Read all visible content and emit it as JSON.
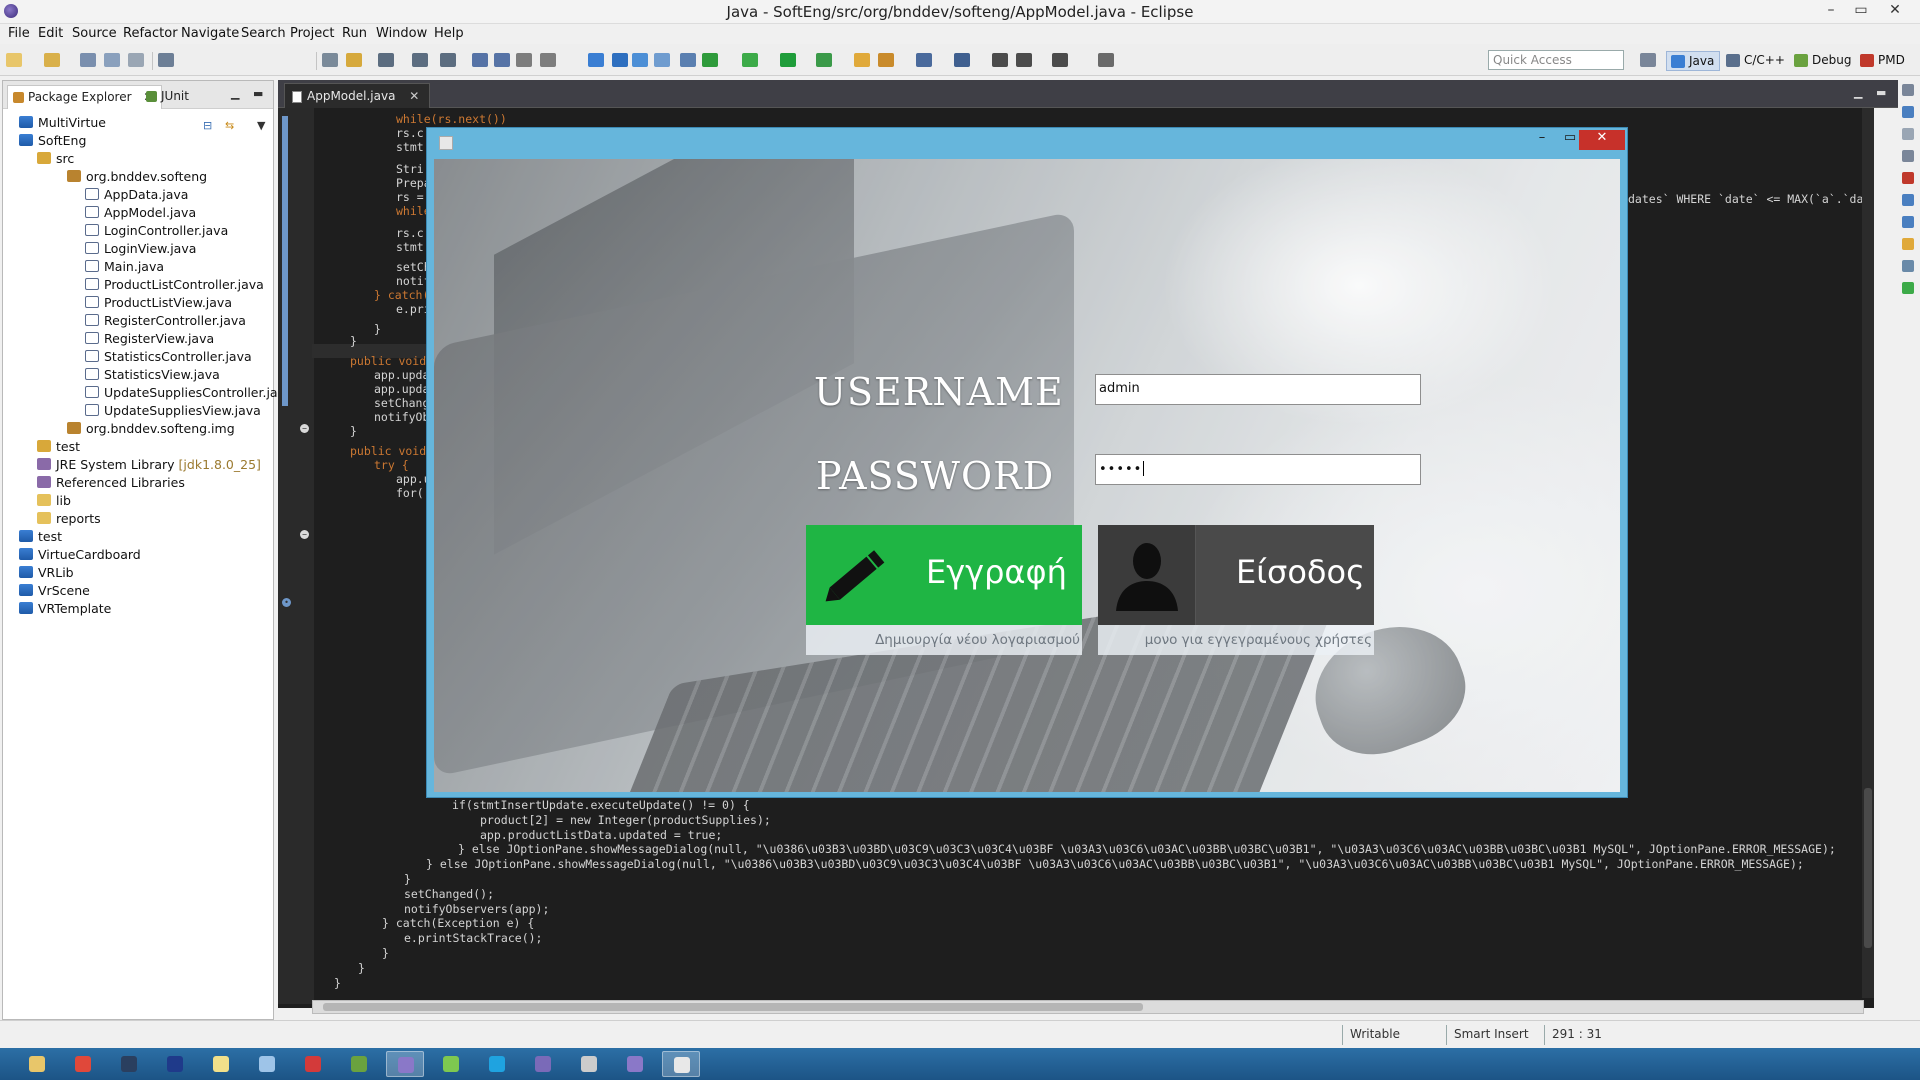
{
  "window": {
    "title": "Java - SoftEng/src/org/bnddev/softeng/AppModel.java - Eclipse",
    "controls": [
      "–",
      "▭",
      "✕"
    ]
  },
  "menu": [
    "File",
    "Edit",
    "Source",
    "Refactor",
    "Navigate",
    "Search",
    "Project",
    "Run",
    "Window",
    "Help"
  ],
  "toolbar": {
    "quick_access_placeholder": "Quick Access",
    "perspectives": [
      {
        "label": "Java",
        "active": true
      },
      {
        "label": "C/C++",
        "active": false
      },
      {
        "label": "Debug",
        "active": false
      },
      {
        "label": "PMD",
        "active": false
      }
    ]
  },
  "left_panel": {
    "tabs": [
      {
        "label": "Package Explorer",
        "active": true,
        "closable": true
      },
      {
        "label": "JUnit",
        "active": false,
        "closable": false
      }
    ],
    "tree": [
      {
        "label": "MultiVirtue",
        "icon": "project-icon",
        "depth": 0
      },
      {
        "label": "SoftEng",
        "icon": "project-icon",
        "depth": 0
      },
      {
        "label": "src",
        "icon": "source-folder-icon",
        "depth": 1
      },
      {
        "label": "org.bnddev.softeng",
        "icon": "package-icon",
        "depth": 2
      },
      {
        "label": "AppData.java",
        "icon": "java-file-icon",
        "depth": 3
      },
      {
        "label": "AppModel.java",
        "icon": "java-file-icon",
        "depth": 3
      },
      {
        "label": "LoginController.java",
        "icon": "java-file-icon",
        "depth": 3
      },
      {
        "label": "LoginView.java",
        "icon": "java-file-icon",
        "depth": 3
      },
      {
        "label": "Main.java",
        "icon": "java-file-icon",
        "depth": 3
      },
      {
        "label": "ProductListController.java",
        "icon": "java-file-icon",
        "depth": 3
      },
      {
        "label": "ProductListView.java",
        "icon": "java-file-icon",
        "depth": 3
      },
      {
        "label": "RegisterController.java",
        "icon": "java-file-icon",
        "depth": 3
      },
      {
        "label": "RegisterView.java",
        "icon": "java-file-icon",
        "depth": 3
      },
      {
        "label": "StatisticsController.java",
        "icon": "java-file-icon",
        "depth": 3
      },
      {
        "label": "StatisticsView.java",
        "icon": "java-file-icon",
        "depth": 3
      },
      {
        "label": "UpdateSuppliesController.java",
        "icon": "java-file-icon",
        "depth": 3
      },
      {
        "label": "UpdateSuppliesView.java",
        "icon": "java-file-icon",
        "depth": 3
      },
      {
        "label": "org.bnddev.softeng.img",
        "icon": "package-icon",
        "depth": 2
      },
      {
        "label": "test",
        "icon": "source-folder-icon",
        "depth": 1
      },
      {
        "label": "JRE System Library",
        "extra": "[jdk1.8.0_25]",
        "icon": "library-icon",
        "depth": 1
      },
      {
        "label": "Referenced Libraries",
        "icon": "library-icon",
        "depth": 1
      },
      {
        "label": "lib",
        "icon": "folder-icon",
        "depth": 1
      },
      {
        "label": "reports",
        "icon": "folder-icon",
        "depth": 1
      },
      {
        "label": "test",
        "icon": "project-icon",
        "depth": 0
      },
      {
        "label": "VirtueCardboard",
        "icon": "project-icon",
        "depth": 0
      },
      {
        "label": "VRLib",
        "icon": "project-icon",
        "depth": 0
      },
      {
        "label": "VrScene",
        "icon": "project-icon",
        "depth": 0
      },
      {
        "label": "VRTemplate",
        "icon": "project-icon",
        "depth": 0
      }
    ]
  },
  "editor": {
    "tab_label": "AppModel.java",
    "top_lines": [
      "while(rs.next())",
      "rs.c",
      "stmt",
      "Stri",
      "Prepa",
      "rs =",
      "while",
      "rs.c",
      "stmt",
      "setCh",
      "notif",
      "} catch(",
      "e.pri",
      "}",
      "}",
      "public void",
      "app.updat",
      "app.updat",
      "setChange",
      "notifyObs",
      "}",
      "public void",
      "try {",
      "app.u",
      "for("
    ],
    "right_fragment": "dates` WHERE `date` <= MAX(`a`.`da",
    "bottom_lines": [
      "if(stmtInsertUpdate.executeUpdate() != 0) {",
      "product[2] = new Integer(productSupplies);",
      "app.productListData.updated = true;",
      "} else JOptionPane.showMessageDialog(null, \"\\u0386\\u03B3\\u03BD\\u03C9\\u03C3\\u03C4\\u03BF \\u03A3\\u03C6\\u03AC\\u03BB\\u03BC\\u03B1\", \"\\u03A3\\u03C6\\u03AC\\u03BB\\u03BC\\u03B1 MySQL\", JOptionPane.ERROR_MESSAGE);",
      "} else JOptionPane.showMessageDialog(null, \"\\u0386\\u03B3\\u03BD\\u03C9\\u03C3\\u03C4\\u03BF \\u03A3\\u03C6\\u03AC\\u03BB\\u03BC\\u03B1\", \"\\u03A3\\u03C6\\u03AC\\u03BB\\u03BC\\u03B1 MySQL\", JOptionPane.ERROR_MESSAGE);",
      "}",
      "setChanged();",
      "notifyObservers(app);",
      "} catch(Exception e) {",
      "e.printStackTrace();",
      "}",
      "}",
      "}"
    ]
  },
  "login_dialog": {
    "username_label": "USERNAME",
    "password_label": "PASSWORD",
    "username_value": "admin",
    "password_value": "•••••",
    "register_button": {
      "label": "Εγγραφή",
      "caption": "Δημιουργία νέου λογαριασμού",
      "color": "#1fb544"
    },
    "login_button": {
      "label": "Είσοδος",
      "caption": "μονο για εγγεγραμένους χρήστες",
      "color": "#4a4a4a"
    },
    "controls": [
      "–",
      "▭",
      "✕"
    ]
  },
  "status_bar": {
    "writable": "Writable",
    "insert_mode": "Smart Insert",
    "position": "291 : 31"
  },
  "taskbar_apps": [
    "file-explorer",
    "chrome",
    "steam",
    "lync",
    "notepad",
    "keyboard",
    "calendar",
    "utorrent",
    "eclipse",
    "evernote",
    "skype",
    "eclipse-alt",
    "media",
    "eclipse-2",
    "java-app"
  ]
}
